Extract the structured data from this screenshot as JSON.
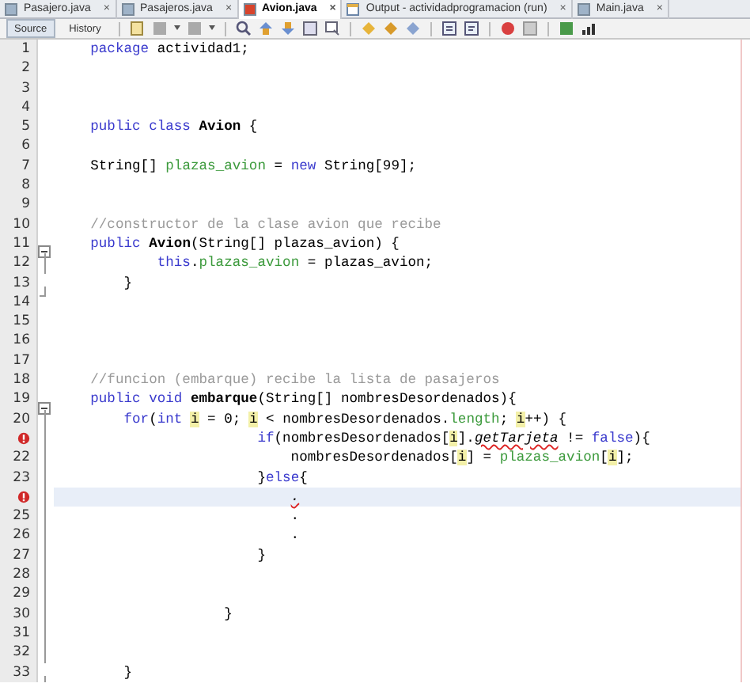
{
  "tabs": [
    {
      "label": "Pasajero.java",
      "selected": false,
      "close": "×"
    },
    {
      "label": "Pasajeros.java",
      "selected": false,
      "close": "×"
    },
    {
      "label": "Avion.java",
      "selected": true,
      "close": "×"
    },
    {
      "label": "Output - actividadprogramacion (run)",
      "selected": false,
      "close": "×",
      "kind": "output"
    },
    {
      "label": "Main.java",
      "selected": false,
      "close": "×"
    }
  ],
  "toolbar": {
    "views": [
      {
        "label": "Source",
        "selected": true
      },
      {
        "label": "History",
        "selected": false
      }
    ]
  },
  "lines": [
    {
      "number": "1",
      "error": false,
      "current": false,
      "tokens": [
        {
          "kind": "kw",
          "text": "    package"
        },
        {
          "kind": "plain",
          "text": " actividad1;"
        }
      ]
    },
    {
      "number": "2",
      "error": false,
      "current": false
    },
    {
      "number": "3",
      "error": false,
      "current": false
    },
    {
      "number": "4",
      "error": false,
      "current": false
    },
    {
      "number": "5",
      "error": false,
      "current": false,
      "tokens": [
        {
          "kind": "kw",
          "text": "    public class "
        },
        {
          "kind": "decl",
          "text": "Avion"
        },
        {
          "kind": "plain",
          "text": " {"
        }
      ]
    },
    {
      "number": "6",
      "error": false,
      "current": false
    },
    {
      "number": "7",
      "error": false,
      "current": false,
      "tokens": [
        {
          "kind": "plain",
          "text": "    String[] "
        },
        {
          "kind": "field",
          "text": "plazas_avion"
        },
        {
          "kind": "plain",
          "text": " = "
        },
        {
          "kind": "kw",
          "text": "new"
        },
        {
          "kind": "plain",
          "text": " String[99];"
        }
      ]
    },
    {
      "number": "8",
      "error": false,
      "current": false
    },
    {
      "number": "9",
      "error": false,
      "current": false
    },
    {
      "number": "10",
      "error": false,
      "current": false,
      "tokens": [
        {
          "kind": "comment",
          "text": "    //constructor de la clase avion que recibe"
        }
      ]
    },
    {
      "number": "11",
      "error": false,
      "current": false,
      "kind": "foldstart",
      "tokens": [
        {
          "kind": "kw",
          "text": "    public "
        },
        {
          "kind": "decl",
          "text": "Avion"
        },
        {
          "kind": "plain",
          "text": "(String[] plazas_avion) {"
        }
      ]
    },
    {
      "number": "12",
      "error": false,
      "current": false,
      "tokens": [
        {
          "kind": "kw",
          "text": "            this"
        },
        {
          "kind": "plain",
          "text": "."
        },
        {
          "kind": "field",
          "text": "plazas_avion"
        },
        {
          "kind": "plain",
          "text": " = plazas_avion;"
        }
      ]
    },
    {
      "number": "13",
      "error": false,
      "current": false,
      "kind": "foldend",
      "tokens": [
        {
          "kind": "plain",
          "text": "        }"
        }
      ]
    },
    {
      "number": "14",
      "error": false,
      "current": false
    },
    {
      "number": "15",
      "error": false,
      "current": false
    },
    {
      "number": "16",
      "error": false,
      "current": false
    },
    {
      "number": "17",
      "error": false,
      "current": false
    },
    {
      "number": "18",
      "error": false,
      "current": false,
      "tokens": [
        {
          "kind": "comment",
          "text": "    //funcion (embarque) recibe la lista de pasajeros"
        }
      ]
    },
    {
      "number": "19",
      "error": false,
      "current": false,
      "kind": "foldstart",
      "tokens": [
        {
          "kind": "kw",
          "text": "    public void "
        },
        {
          "kind": "decl",
          "text": "embarque"
        },
        {
          "kind": "plain",
          "text": "(String[] nombresDesordenados){"
        }
      ]
    },
    {
      "number": "20",
      "error": false,
      "current": false,
      "tokens": [
        {
          "kind": "kw",
          "text": "        for"
        },
        {
          "kind": "plain",
          "text": "("
        },
        {
          "kind": "kw",
          "text": "int "
        },
        {
          "kind": "var",
          "text": "i"
        },
        {
          "kind": "plain",
          "text": " = 0; "
        },
        {
          "kind": "var",
          "text": "i"
        },
        {
          "kind": "plain",
          "text": " < nombresDesordenados."
        },
        {
          "kind": "field",
          "text": "length"
        },
        {
          "kind": "plain",
          "text": "; "
        },
        {
          "kind": "var",
          "text": "i"
        },
        {
          "kind": "plain",
          "text": "++) {"
        }
      ]
    },
    {
      "error": true,
      "current": false,
      "tokens": [
        {
          "kind": "kw",
          "text": "                        if"
        },
        {
          "kind": "plain",
          "text": "(nombresDesordenados["
        },
        {
          "kind": "var",
          "text": "i"
        },
        {
          "kind": "plain",
          "text": "]."
        },
        {
          "kind": "error",
          "text": "getTarjeta"
        },
        {
          "kind": "plain",
          "text": " != "
        },
        {
          "kind": "kw",
          "text": "false"
        },
        {
          "kind": "plain",
          "text": "){"
        }
      ]
    },
    {
      "number": "22",
      "error": false,
      "current": false,
      "tokens": [
        {
          "kind": "plain",
          "text": "                            nombresDesordenados["
        },
        {
          "kind": "var",
          "text": "i"
        },
        {
          "kind": "plain",
          "text": "] = "
        },
        {
          "kind": "field",
          "text": "plazas_avion"
        },
        {
          "kind": "plain",
          "text": "["
        },
        {
          "kind": "var",
          "text": "i"
        },
        {
          "kind": "plain",
          "text": "];"
        }
      ]
    },
    {
      "number": "23",
      "error": false,
      "current": false,
      "tokens": [
        {
          "kind": "plain",
          "text": "                        }"
        },
        {
          "kind": "kw",
          "text": "else"
        },
        {
          "kind": "plain",
          "text": "{"
        }
      ]
    },
    {
      "error": true,
      "current": true,
      "tokens": [
        {
          "kind": "error",
          "text": "                            ."
        }
      ]
    },
    {
      "number": "25",
      "error": false,
      "current": false,
      "tokens": [
        {
          "kind": "plain",
          "text": "                            ."
        }
      ]
    },
    {
      "number": "26",
      "error": false,
      "current": false,
      "tokens": [
        {
          "kind": "plain",
          "text": "                            ."
        }
      ]
    },
    {
      "number": "27",
      "error": false,
      "current": false,
      "tokens": [
        {
          "kind": "plain",
          "text": "                        }"
        }
      ]
    },
    {
      "number": "28",
      "error": false,
      "current": false
    },
    {
      "number": "29",
      "error": false,
      "current": false
    },
    {
      "number": "30",
      "error": false,
      "current": false,
      "tokens": [
        {
          "kind": "plain",
          "text": "                    }"
        }
      ]
    },
    {
      "number": "31",
      "error": false,
      "current": false
    },
    {
      "number": "32",
      "error": false,
      "current": false
    },
    {
      "number": "33",
      "error": false,
      "current": false,
      "kind": "foldend",
      "tokens": [
        {
          "kind": "plain",
          "text": "        }"
        }
      ]
    }
  ]
}
